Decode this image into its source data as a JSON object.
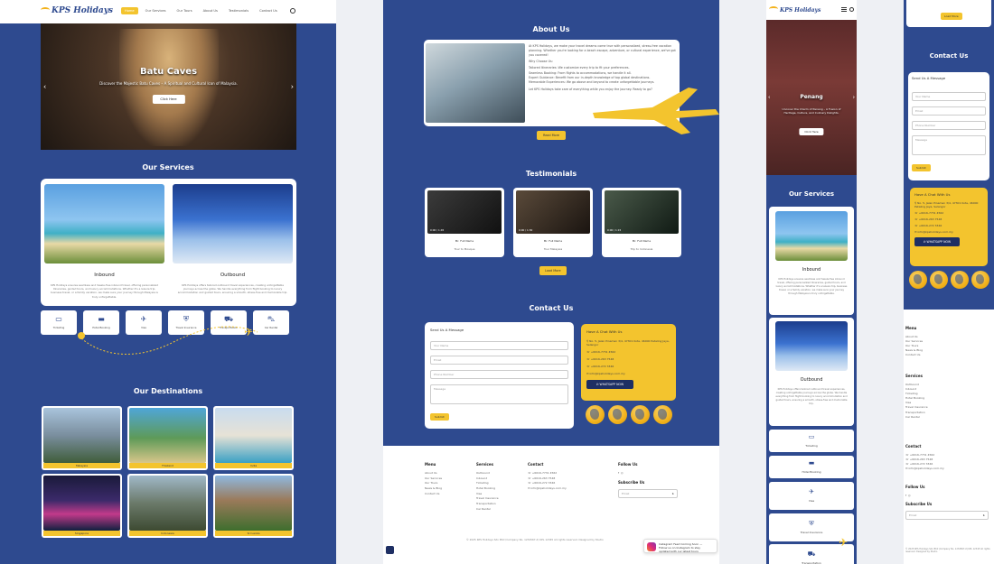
{
  "brand": {
    "logo": "KPS Holidays"
  },
  "nav": {
    "items": [
      "Home",
      "Our Services",
      "Our Tours",
      "About Us",
      "Testimonials",
      "Contact Us"
    ]
  },
  "hero": {
    "title": "Batu Caves",
    "subtitle": "Discover the Majestic Batu Caves – A Spiritual and Cultural Icon of Malaysia.",
    "button": "Click Here"
  },
  "services": {
    "title": "Our Services",
    "inbound": {
      "title": "Inbound",
      "desc": "KPS Holidays ensures seamless and hassle-free inbound travel, offering personalized itineraries, guided tours, and luxury accommodations. Whether it's a leisure trip, business travel, or a family vacation, we make sure your journey through Malaysia is truly unforgettable."
    },
    "outbound": {
      "title": "Outbound",
      "desc": "KPS Holidays offers tailored outbound travel experiences, creating unforgettable journeys across the globe. We handle everything from flight booking to luxury accommodation and guided tours, ensuring a smooth, stress-free and memorable trip."
    },
    "tiles": [
      {
        "icon": "ticket-icon",
        "glyph": "▭",
        "label": "Ticketing"
      },
      {
        "icon": "hotel-bed-icon",
        "glyph": "▬",
        "label": "Hotel Booking"
      },
      {
        "icon": "plane-icon",
        "glyph": "✈",
        "label": "Visa"
      },
      {
        "icon": "shield-icon",
        "glyph": "⛨",
        "label": "Travel Insurance"
      },
      {
        "icon": "bus-icon",
        "glyph": "⛟",
        "label": "Transportation"
      },
      {
        "icon": "car-icon",
        "glyph": "⛍",
        "label": "Car Rental"
      }
    ]
  },
  "destinations": {
    "title": "Our Destinations",
    "items": [
      "Malaysia",
      "Thailand",
      "India",
      "Singapore",
      "Indonesia",
      "Sri Lanka"
    ]
  },
  "about": {
    "title": "About Us",
    "intro": "At KPS Holidays, we make your travel dreams come true with personalized, stress-free vacation planning. Whether you're looking for a beach escape, adventure, or cultural experience, we've got you covered!",
    "why": "Why Choose Us:",
    "bullets": [
      "Tailored Itineraries: We customize every trip to fit your preferences.",
      "Seamless Booking: From flights to accommodations, we handle it all.",
      "Expert Guidance: Benefit from our in-depth knowledge of top global destinations.",
      "Memorable Experiences: We go above and beyond to create unforgettable journeys."
    ],
    "closing": "Let KPS Holidays take care of everything while you enjoy the journey. Ready to go?",
    "button": "Read More"
  },
  "testimonials": {
    "title": "Testimonials",
    "items": [
      {
        "time": "0:00 / 1:45",
        "name": "Mr. Full Name",
        "role": "Tour to Mosque"
      },
      {
        "time": "0:00 / 1:30",
        "name": "Mr. Full Name",
        "role": "Tour Malaysia"
      },
      {
        "time": "0:00 / 1:15",
        "name": "Mr. Full Name",
        "role": "Trip to Indonesia"
      }
    ],
    "button": "Load More"
  },
  "contact": {
    "title": "Contact Us",
    "form": {
      "heading": "Send Us A Message",
      "name": "Your Name",
      "email": "Email",
      "phone": "Phone Number",
      "message": "Message",
      "submit": "Submit"
    },
    "info": {
      "heading": "Have A Chat With Us",
      "address": "No. 5, Jalan Pinaman 3/4, 47301 Kota, 46000 Petaling Jaya, Selangor",
      "phone1": "+6016-7731 4562",
      "phone2": "+6016-263 7548",
      "phone3": "+6016-272 3346",
      "email": "info@kpsholidays.com.my",
      "whatsapp": "WHATSAPP NOW"
    }
  },
  "footer": {
    "menu": {
      "heading": "Menu",
      "items": [
        "About Us",
        "Our Services",
        "Our Tours",
        "News & Blog",
        "Contact Us"
      ]
    },
    "services": {
      "heading": "Services",
      "items": [
        "Outbound",
        "Inbound",
        "Ticketing",
        "Hotel Booking",
        "Visa",
        "Travel Insurance",
        "Transportation",
        "Car Rental"
      ]
    },
    "contact": {
      "heading": "Contact",
      "items": [
        "+6016-7731 4562",
        "+6016-263 7548",
        "+6016-272 3346",
        "info@kpsholidays.com.my"
      ]
    },
    "follow": {
      "heading": "Follow Us"
    },
    "subscribe": {
      "heading": "Subscribe Us",
      "placeholder": "Email"
    },
    "copyright": "© 2025 KPS Holidays Sdn Bhd (Company No. 1234567-X) KPL 12345 All rights reserved. Designed by Studio",
    "instagram": "Instagram Feed Coming Soon — Follow us on Instagram to stay updated with our latest tours"
  },
  "mobile": {
    "hero": {
      "title": "Penang",
      "subtitle": "Uncover the Charm of Penang – A Fusion of Heritage, Culture, and Culinary Delights.",
      "button": "Click Here"
    },
    "tiles": [
      {
        "icon": "ticket-icon",
        "glyph": "▭",
        "label": "Ticketing"
      },
      {
        "icon": "hotel-bed-icon",
        "glyph": "▬",
        "label": "Hotel Booking"
      },
      {
        "icon": "plane-icon",
        "glyph": "✈",
        "label": "Visa"
      },
      {
        "icon": "shield-icon",
        "glyph": "⛨",
        "label": "Travel Insurance"
      },
      {
        "icon": "bus-icon",
        "glyph": "⛟",
        "label": "Transportation"
      }
    ],
    "top_button": "Load More"
  },
  "colors": {
    "primary": "#2e4a8f",
    "accent": "#f3c42e",
    "dark": "#1e2f63"
  }
}
